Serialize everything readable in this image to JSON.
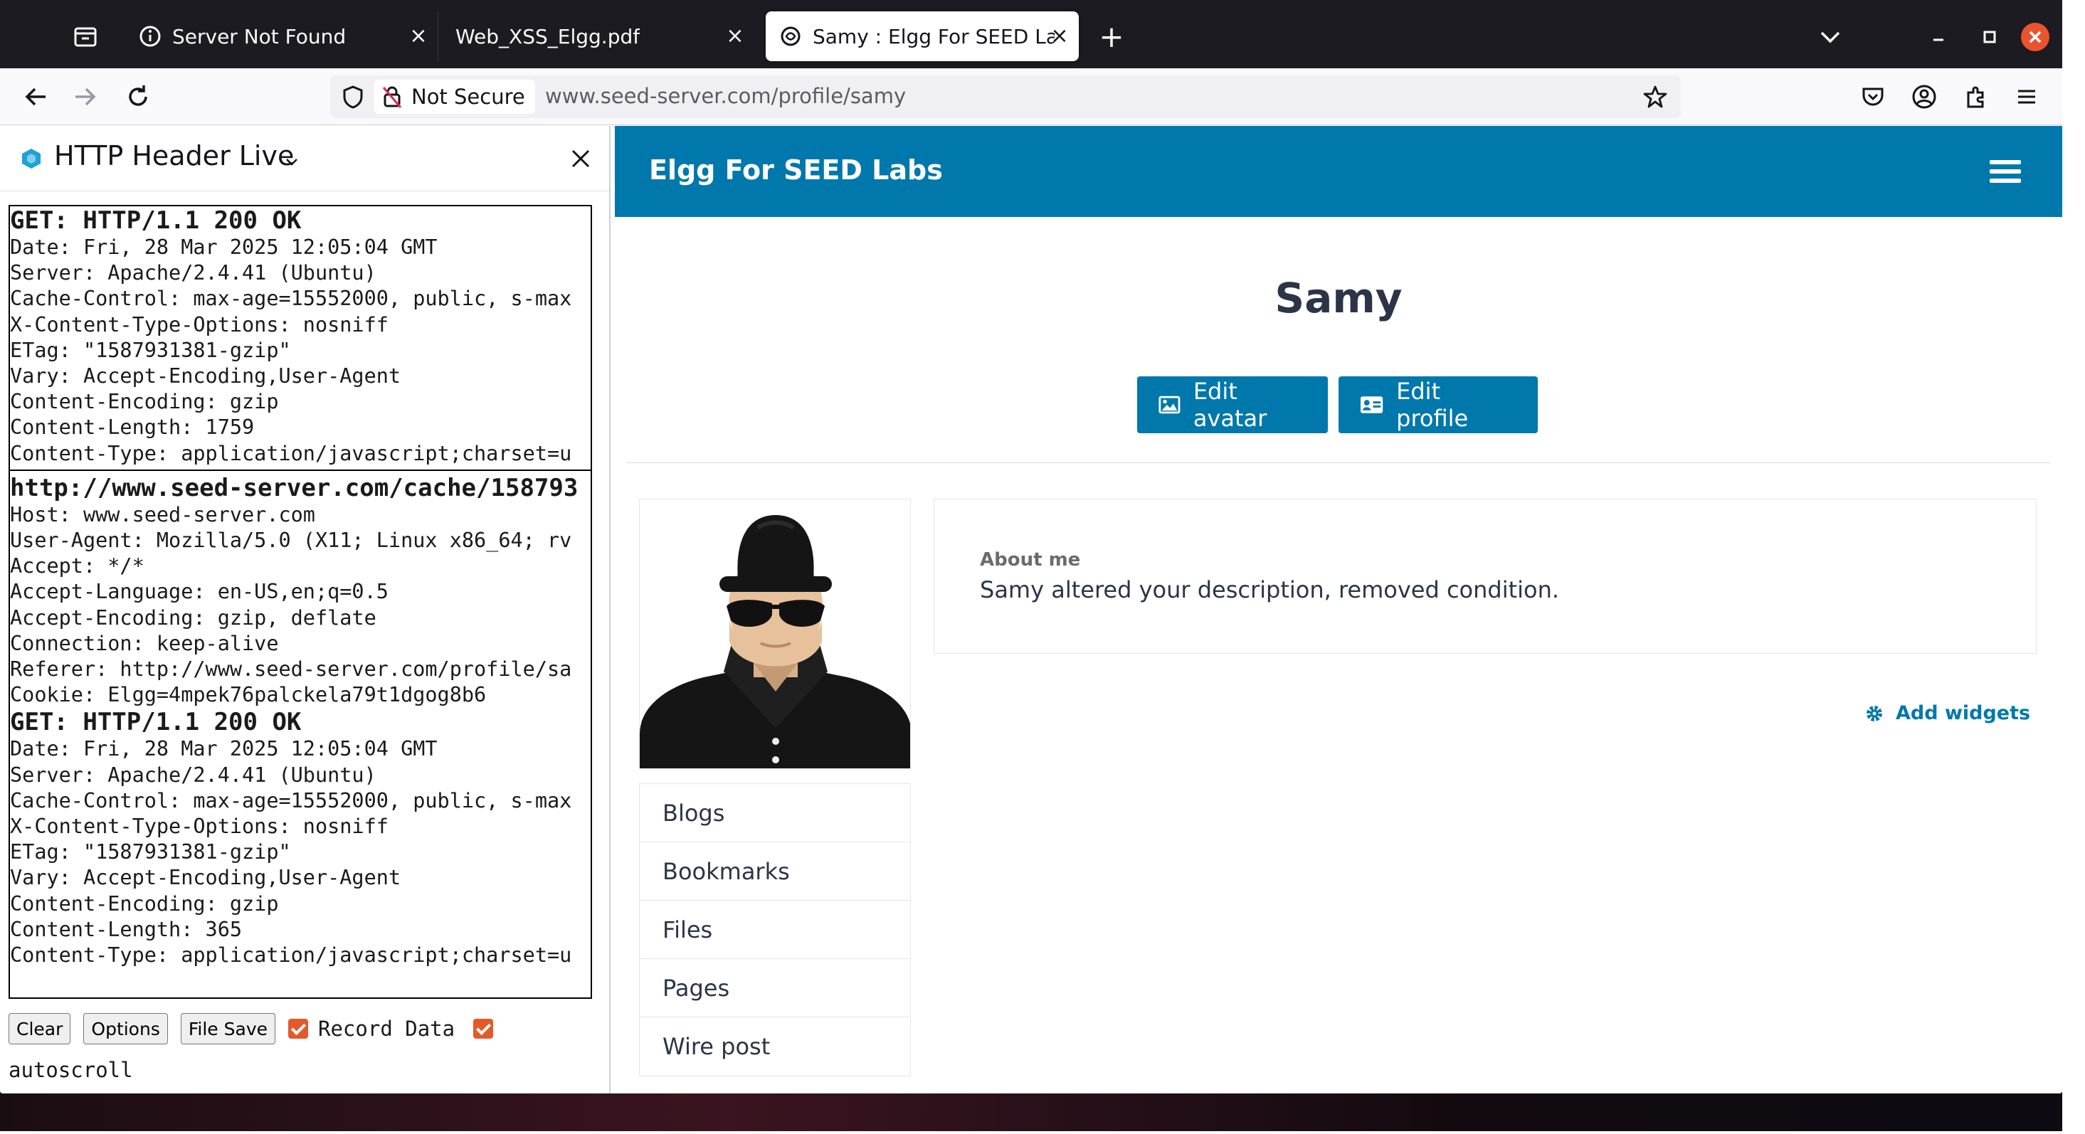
{
  "browser": {
    "tabs": [
      {
        "label": "Server Not Found"
      },
      {
        "label": "Web_XSS_Elgg.pdf"
      },
      {
        "label": "Samy : Elgg For SEED Lab"
      }
    ],
    "new_tab": "+",
    "security_label": "Not Secure",
    "url_host": "www.seed-server.com",
    "url_path": "/profile/samy"
  },
  "sidebar": {
    "title": "HTTP Header Live",
    "log": [
      {
        "type": "header",
        "text": "GET: HTTP/1.1 200 OK"
      },
      {
        "type": "line",
        "text": "Date: Fri, 28 Mar 2025 12:05:04 GMT"
      },
      {
        "type": "line",
        "text": "Server: Apache/2.4.41 (Ubuntu)"
      },
      {
        "type": "line",
        "text": "Cache-Control: max-age=15552000, public, s-max"
      },
      {
        "type": "line",
        "text": "X-Content-Type-Options: nosniff"
      },
      {
        "type": "line",
        "text": "ETag: \"1587931381-gzip\""
      },
      {
        "type": "line",
        "text": "Vary: Accept-Encoding,User-Agent"
      },
      {
        "type": "line",
        "text": "Content-Encoding: gzip"
      },
      {
        "type": "line",
        "text": "Content-Length: 1759"
      },
      {
        "type": "line",
        "text": "Content-Type: application/javascript;charset=u"
      },
      {
        "type": "sep",
        "text": ""
      },
      {
        "type": "header",
        "text": "http://www.seed-server.com/cache/158793"
      },
      {
        "type": "line",
        "text": "Host: www.seed-server.com"
      },
      {
        "type": "line",
        "text": "User-Agent: Mozilla/5.0 (X11; Linux x86_64; rv"
      },
      {
        "type": "line",
        "text": "Accept: */*"
      },
      {
        "type": "line",
        "text": "Accept-Language: en-US,en;q=0.5"
      },
      {
        "type": "line",
        "text": "Accept-Encoding: gzip, deflate"
      },
      {
        "type": "line",
        "text": "Connection: keep-alive"
      },
      {
        "type": "line",
        "text": "Referer: http://www.seed-server.com/profile/sa"
      },
      {
        "type": "line",
        "text": "Cookie: Elgg=4mpek76palckela79t1dgog8b6"
      },
      {
        "type": "header",
        "text": "GET: HTTP/1.1 200 OK"
      },
      {
        "type": "line",
        "text": "Date: Fri, 28 Mar 2025 12:05:04 GMT"
      },
      {
        "type": "line",
        "text": "Server: Apache/2.4.41 (Ubuntu)"
      },
      {
        "type": "line",
        "text": "Cache-Control: max-age=15552000, public, s-max"
      },
      {
        "type": "line",
        "text": "X-Content-Type-Options: nosniff"
      },
      {
        "type": "line",
        "text": "ETag: \"1587931381-gzip\""
      },
      {
        "type": "line",
        "text": "Vary: Accept-Encoding,User-Agent"
      },
      {
        "type": "line",
        "text": "Content-Encoding: gzip"
      },
      {
        "type": "line",
        "text": "Content-Length: 365"
      },
      {
        "type": "line",
        "text": "Content-Type: application/javascript;charset=u"
      }
    ],
    "buttons": {
      "clear": "Clear",
      "options": "Options",
      "file_save": "File Save"
    },
    "record_data_label": "Record Data",
    "record_data_checked": true,
    "autoscroll_checked": true,
    "autoscroll_label": "autoscroll"
  },
  "page": {
    "site_name": "Elgg For SEED Labs",
    "profile_name": "Samy",
    "edit_avatar": "Edit avatar",
    "edit_profile": "Edit profile",
    "about_label": "About me",
    "about_text": "Samy altered your description, removed condition.",
    "menu": [
      "Blogs",
      "Bookmarks",
      "Files",
      "Pages",
      "Wire post"
    ],
    "add_widgets": "Add widgets"
  },
  "colors": {
    "accent": "#0078ac",
    "tabbar": "#1c1b22",
    "checkbox": "#e35a2a",
    "close_button": "#e9542f"
  },
  "icons": [
    "tab-list-icon",
    "info-icon",
    "elgg-favicon-icon",
    "back-arrow-icon",
    "forward-arrow-icon",
    "reload-icon",
    "shield-icon",
    "lock-slash-icon",
    "star-icon",
    "pocket-icon",
    "account-icon",
    "extensions-icon",
    "menu-icon",
    "image-icon",
    "id-card-icon",
    "gear-icon"
  ]
}
